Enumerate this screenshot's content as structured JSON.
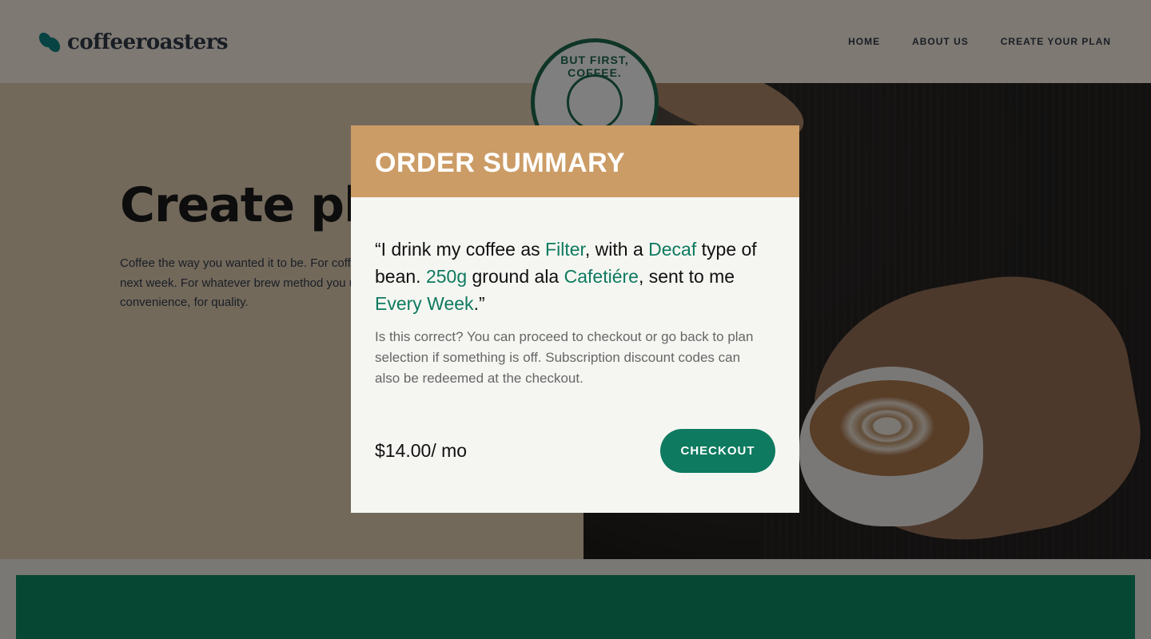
{
  "header": {
    "logo_text": "coffeeroasters",
    "nav": [
      "HOME",
      "ABOUT US",
      "CREATE YOUR PLAN"
    ]
  },
  "hero": {
    "title": "Create plan",
    "description": "Coffee the way you wanted it to be. For coffee delivered tomorrow, or next week. For whatever brew method you use. For choice, for convenience, for quality."
  },
  "badge": {
    "text": "BUT FIRST, COFFEE."
  },
  "modal": {
    "title": "ORDER SUMMARY",
    "summary": {
      "p1": "“I drink my coffee as ",
      "how": "Filter",
      "p2": ", with a ",
      "type": "Decaf",
      "p3": " type of bean. ",
      "quantity": "250g",
      "p4": " ground ala ",
      "grind": "Cafetiére",
      "p5": ", sent to me ",
      "frequency": "Every Week",
      "p6": ".”"
    },
    "note": "Is this correct? You can proceed to checkout or go back to plan selection if something is off. Subscription discount codes can also be redeemed at the checkout.",
    "price": "$14.00/ mo",
    "checkout_label": "CHECKOUT"
  },
  "colors": {
    "accent": "#0e7a5f",
    "header_band": "#cc9c66",
    "modal_bg": "#f5f6f2"
  }
}
